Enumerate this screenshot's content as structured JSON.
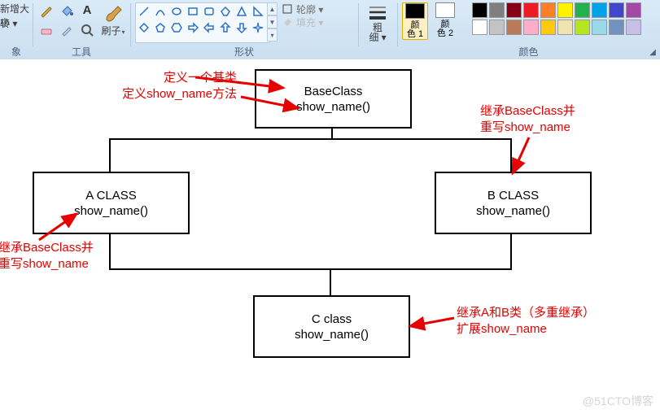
{
  "ribbon": {
    "groups": {
      "image": {
        "label": "象",
        "resize": "新增大小",
        "rotate": "转 ▾"
      },
      "tools": {
        "label": "工具",
        "brush": "刷子"
      },
      "shapes": {
        "label": "形状",
        "outline": "轮廓 ▾",
        "fill": "填充 ▾"
      },
      "linew": {
        "label": "",
        "name": "粗\n细 ▾"
      },
      "colors": {
        "label": "颜色",
        "c1": "颜\n色 1",
        "c2": "颜\n色 2"
      }
    },
    "palette_row1": [
      "#000000",
      "#7f7f7f",
      "#880015",
      "#ed1c24",
      "#ff7f27",
      "#fff200",
      "#22b14c",
      "#00a2e8",
      "#3f48cc",
      "#a349a4"
    ],
    "palette_row2": [
      "#ffffff",
      "#c3c3c3",
      "#b97a57",
      "#ffaec9",
      "#ffc90e",
      "#efe4b0",
      "#b5e61d",
      "#99d9ea",
      "#7092be",
      "#c8bfe7"
    ]
  },
  "diagram": {
    "base": {
      "title": "BaseClass",
      "method": "show_name()"
    },
    "a": {
      "title": "A CLASS",
      "method": "show_name()"
    },
    "b": {
      "title": "B CLASS",
      "method": "show_name()"
    },
    "c": {
      "title": "C class",
      "method": "show_name()"
    },
    "annot_base_l1": "定义一个基类",
    "annot_base_l2": "定义show_name方法",
    "annot_a_l1": "继承BaseClass并",
    "annot_a_l2": "重写show_name",
    "annot_b_l1": "继承BaseClass并",
    "annot_b_l2": "重写show_name",
    "annot_c_l1": "继承A和B类（多重继承）",
    "annot_c_l2": "扩展show_name"
  },
  "watermark": "@51CTO博客"
}
